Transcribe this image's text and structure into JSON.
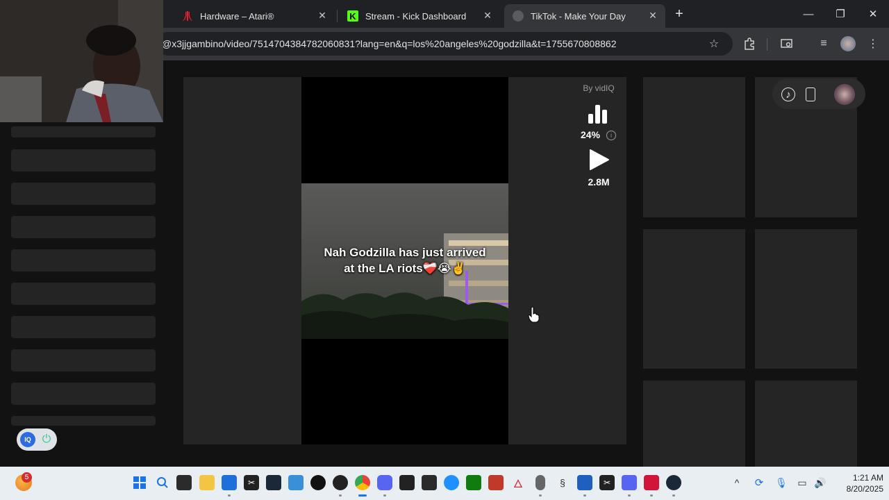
{
  "browser": {
    "tabs": [
      {
        "title": "Hardware – Atari®",
        "favicon": "atari-icon",
        "active": false
      },
      {
        "title": "Stream - Kick Dashboard",
        "favicon": "kick-icon",
        "active": false
      },
      {
        "title": "TikTok - Make Your Day",
        "favicon": "tiktok-icon",
        "active": true
      }
    ],
    "new_tab_label": "+",
    "url": "@x3jjgambino/video/7514704384782060831?lang=en&q=los%20angeles%20godzilla&t=1755670808862"
  },
  "video": {
    "caption_line1": "Nah Godzilla has just arrived",
    "caption_line2": "at the LA riots❤️‍🩹😭✌️"
  },
  "vidiq": {
    "by_label": "By vidIQ",
    "score": "24%",
    "views": "2.8M",
    "toggle_colors": {
      "badge": "#2d6cdf",
      "power": "#35c98a"
    }
  },
  "taskbar": {
    "notification_count": "5",
    "time": "1:21 AM",
    "date": "8/20/2025"
  },
  "colors": {
    "page_bg": "#121212",
    "panel": "#252525",
    "tab_active": "#35363a",
    "kick_green": "#53fc18",
    "atari_red": "#e4202e"
  }
}
